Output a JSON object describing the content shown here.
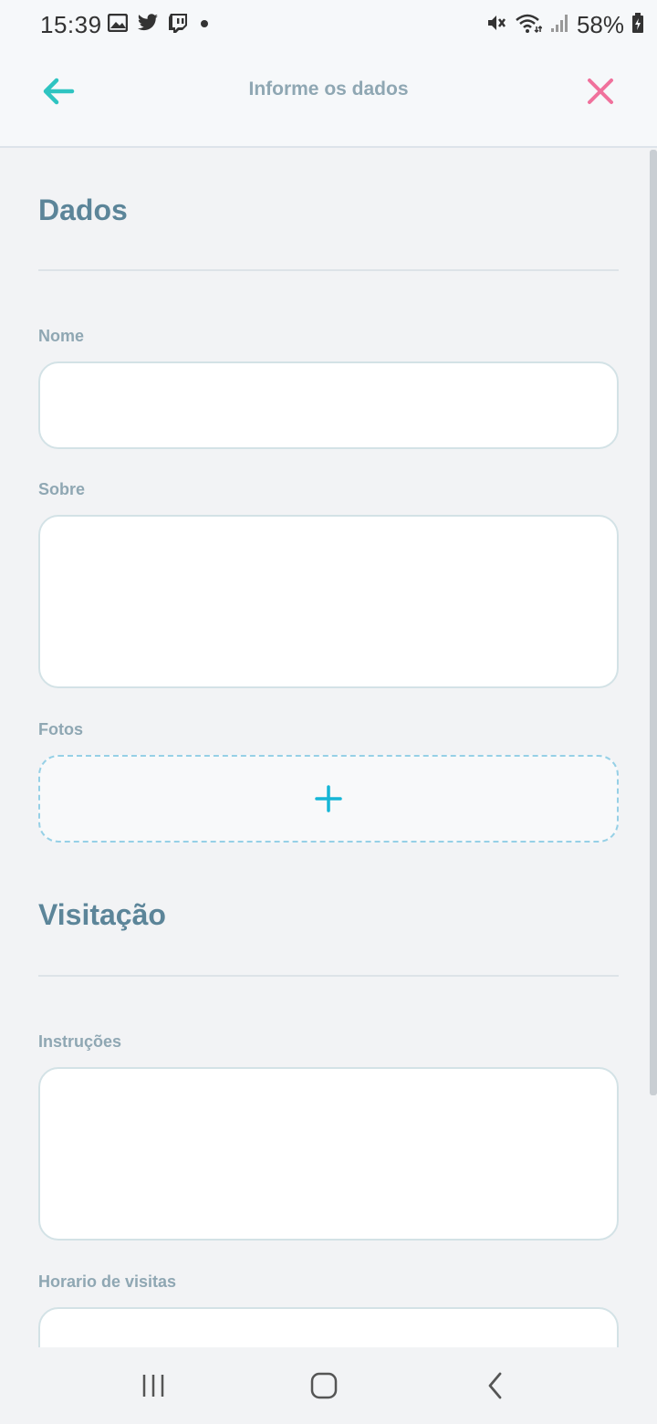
{
  "status_bar": {
    "time": "15:39",
    "battery": "58%",
    "icons_left": [
      "image-icon",
      "twitter-icon",
      "twitch-icon",
      "dot-icon"
    ],
    "icons_right": [
      "mute-icon",
      "wifi-icon",
      "signal-icon",
      "battery-icon"
    ]
  },
  "header": {
    "title": "Informe os dados",
    "back_color": "#2ec4c1",
    "close_color": "#f0719c"
  },
  "sections": {
    "dados": {
      "title": "Dados",
      "nome_label": "Nome",
      "nome_value": "",
      "sobre_label": "Sobre",
      "sobre_value": "",
      "fotos_label": "Fotos"
    },
    "visitacao": {
      "title": "Visitação",
      "instrucoes_label": "Instruções",
      "instrucoes_value": "",
      "horario_label": "Horario de visitas",
      "horario_value": ""
    }
  },
  "colors": {
    "accent": "#15b6d6",
    "section_title": "#5c8599",
    "label": "#8fa7b3"
  }
}
